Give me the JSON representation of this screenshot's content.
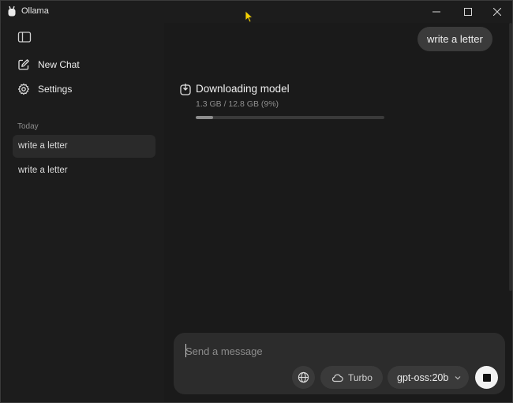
{
  "window": {
    "title": "Ollama"
  },
  "sidebar": {
    "new_chat_label": "New Chat",
    "settings_label": "Settings",
    "section_label": "Today",
    "chats": [
      {
        "label": "write a letter",
        "active": true
      },
      {
        "label": "write a letter",
        "active": false
      }
    ]
  },
  "conversation": {
    "user_message": "write a letter"
  },
  "download": {
    "title": "Downloading model",
    "status": "1.3 GB / 12.8 GB (9%)",
    "progress_fraction": 0.09
  },
  "composer": {
    "placeholder": "Send a message",
    "turbo_label": "Turbo",
    "model_label": "gpt-oss:20b"
  },
  "icons": {
    "app": "ollama-icon",
    "sidebar_toggle": "sidebar-toggle-icon",
    "new_chat": "edit-icon",
    "settings": "gear-icon",
    "download": "download-icon",
    "globe": "globe-icon",
    "turbo": "cloud-icon",
    "model_dropdown": "chevron-down-icon",
    "stop": "stop-icon"
  },
  "colors": {
    "background": "#1a1a1a",
    "sidebar": "#1c1c1c",
    "bubble": "#3b3b3b",
    "composer": "#2c2c2c",
    "stop_button": "#f2f2f2"
  }
}
